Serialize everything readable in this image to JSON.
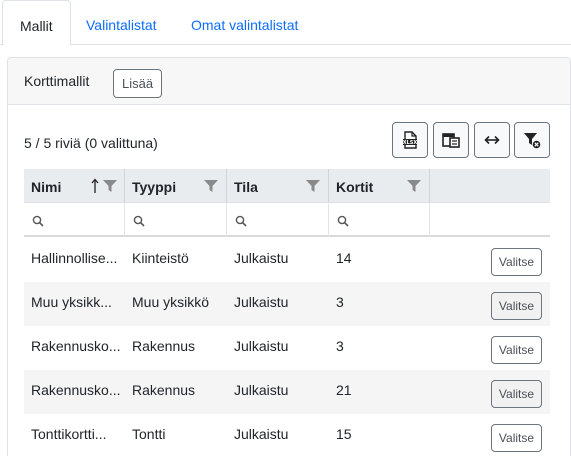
{
  "tabs": [
    {
      "label": "Mallit",
      "active": true
    },
    {
      "label": "Valintalistat",
      "active": false
    },
    {
      "label": "Omat valintalistat",
      "active": false
    }
  ],
  "panel": {
    "title": "Korttimallit",
    "add_button": "Lisää"
  },
  "grid": {
    "row_count": "5 / 5 riviä (0 valittuna)",
    "toolbar": [
      "excel-export-icon",
      "column-chooser-icon",
      "fit-columns-icon",
      "clear-filter-icon"
    ],
    "columns": [
      {
        "label": "Nimi",
        "sorted": "ascending"
      },
      {
        "label": "Tyyppi"
      },
      {
        "label": "Tila"
      },
      {
        "label": "Kortit"
      }
    ],
    "rows": [
      {
        "nimi": "Hallinnollise...",
        "tyyppi": "Kiinteistö",
        "tila": "Julkaistu",
        "kortit": "14",
        "action": "Valitse"
      },
      {
        "nimi": "Muu yksikk...",
        "tyyppi": "Muu yksikkö",
        "tila": "Julkaistu",
        "kortit": "3",
        "action": "Valitse"
      },
      {
        "nimi": "Rakennusko...",
        "tyyppi": "Rakennus",
        "tila": "Julkaistu",
        "kortit": "3",
        "action": "Valitse"
      },
      {
        "nimi": "Rakennusko...",
        "tyyppi": "Rakennus",
        "tila": "Julkaistu",
        "kortit": "21",
        "action": "Valitse"
      },
      {
        "nimi": "Tonttikortti...",
        "tyyppi": "Tontti",
        "tila": "Julkaistu",
        "kortit": "15",
        "action": "Valitse"
      }
    ]
  },
  "colors": {
    "link": "#0d6efd",
    "header_bg": "#e9ecef",
    "stripe": "#f5f5f5",
    "icon_gray": "#8a8a8a"
  }
}
